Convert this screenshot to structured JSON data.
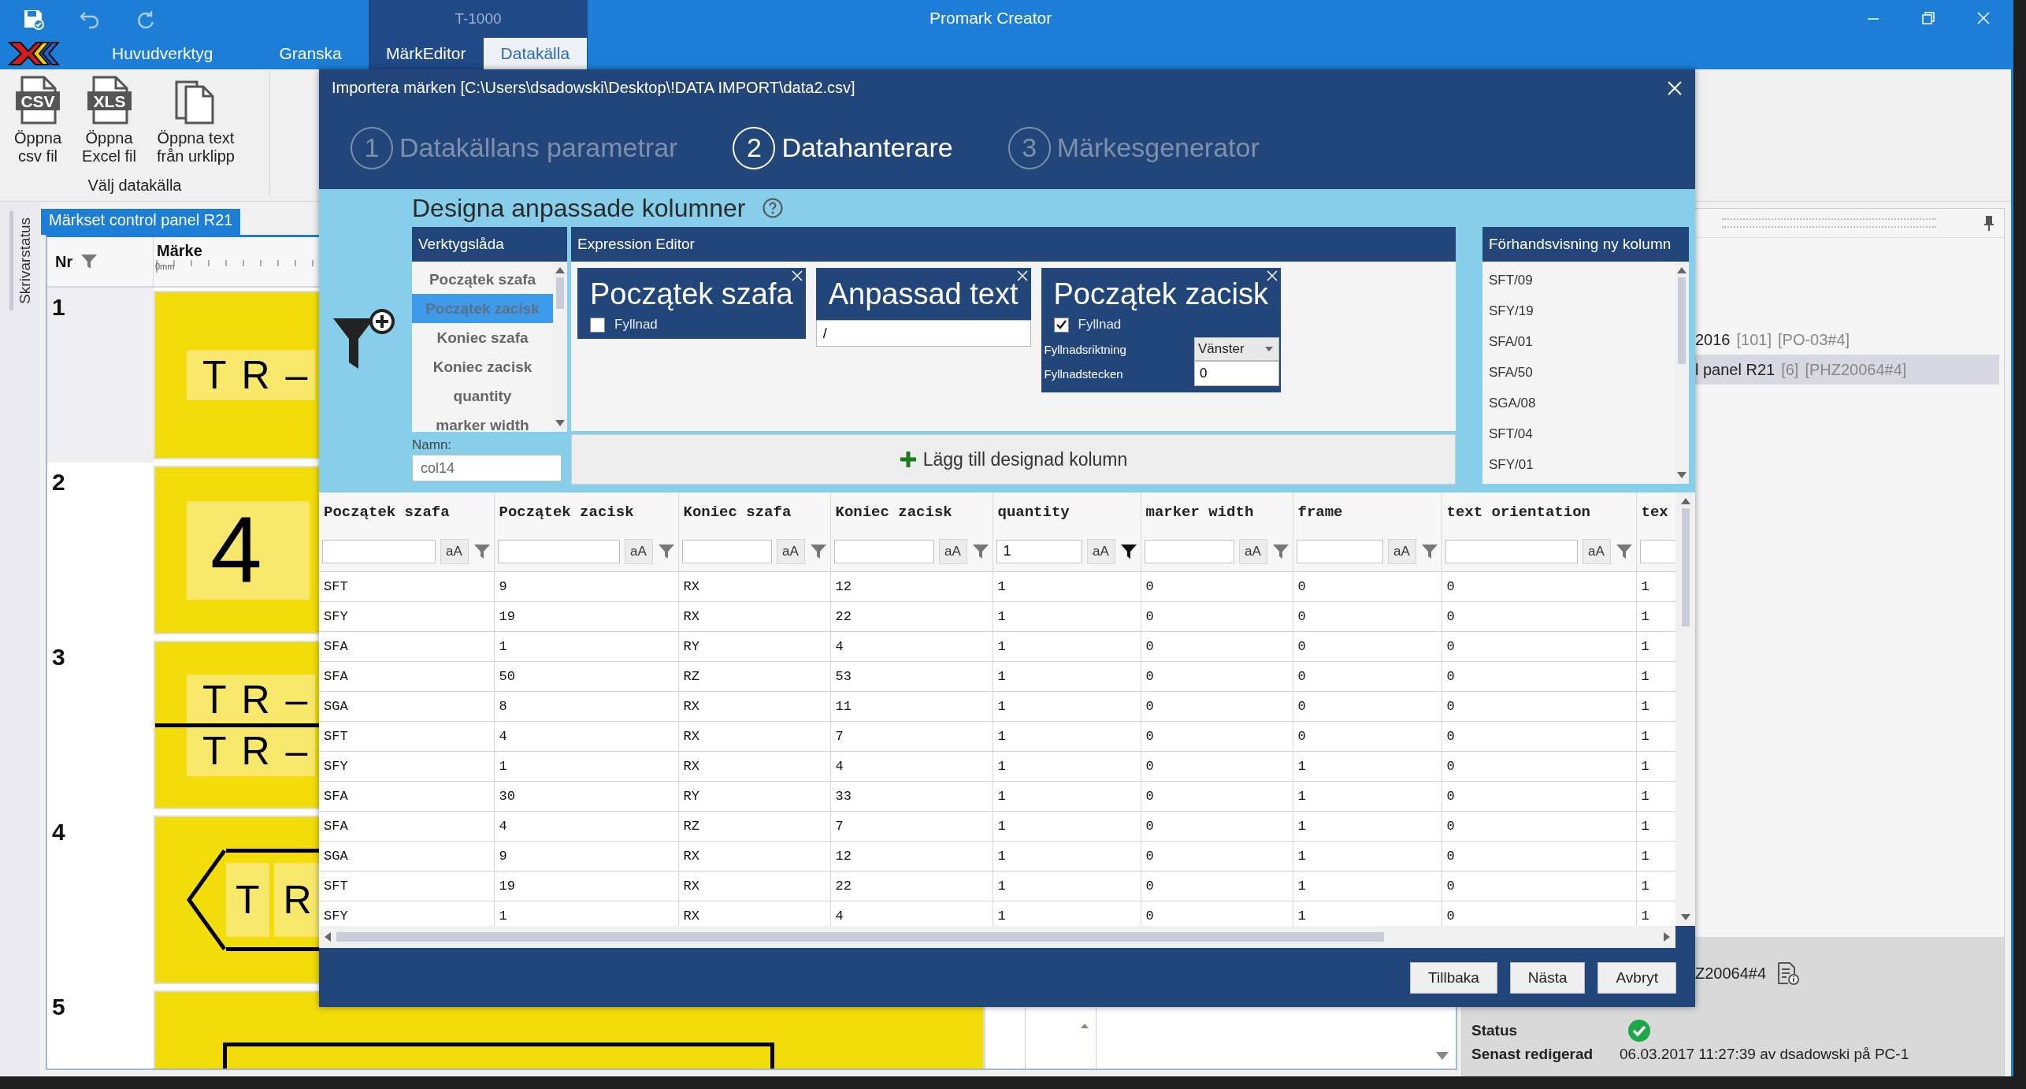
{
  "app": {
    "title": "Promark Creator",
    "tabs": [
      {
        "label": "Huvudverktyg",
        "selected": false
      },
      {
        "label": "Granska",
        "selected": false
      }
    ],
    "context_group": {
      "label": "T-1000",
      "tabs": [
        {
          "label": "MärkEditor",
          "selected": false
        },
        {
          "label": "Datakälla",
          "selected": true
        }
      ]
    }
  },
  "ribbon": {
    "groups": [
      {
        "label": "Välj datakälla",
        "buttons": [
          {
            "label": "Öppna\ncsv fil",
            "kind": "file-badge",
            "badge": "CSV"
          },
          {
            "label": "Öppna\nExcel fil",
            "kind": "file-badge",
            "badge": "XLS"
          },
          {
            "label": "Öppna text\nfrån urklipp",
            "kind": "clipboard"
          }
        ]
      }
    ]
  },
  "document": {
    "side_tab": "Skrivarstatus",
    "tab": "Märkset control panel R21",
    "nr_header": "Nr",
    "marker_header": "Märke",
    "ruler_label": "0mm",
    "markers": [
      {
        "number": "1",
        "selected": true,
        "kind": "single",
        "lines": [
          "T R –"
        ]
      },
      {
        "number": "2",
        "selected": false,
        "kind": "big",
        "lines": [
          "4"
        ]
      },
      {
        "number": "3",
        "selected": false,
        "kind": "double",
        "lines": [
          "T R –",
          "T R –"
        ]
      },
      {
        "number": "4",
        "selected": false,
        "kind": "arrow",
        "lines": [
          "T",
          "R"
        ]
      },
      {
        "number": "5",
        "selected": false,
        "kind": "frame"
      }
    ]
  },
  "right_panel": {
    "items": [
      {
        "name": "2016",
        "count": "[101]",
        "code": "[PO-03#4]",
        "selected": false
      },
      {
        "name": "l panel R21",
        "count": "[6]",
        "code": "[PHZ20064#4]",
        "selected": true
      }
    ],
    "info": {
      "id": "Z20064#4",
      "status_label": "Status",
      "status_ok": true,
      "edited_label": "Senast redigerad",
      "edited": "06.03.2017 11:27:39 av dsadowski på PC-1"
    }
  },
  "dialog": {
    "title": "Importera märken [C:\\Users\\dsadowski\\Desktop\\!DATA IMPORT\\data2.csv]",
    "steps": [
      {
        "number": "1",
        "label": "Datakällans parametrar",
        "selected": false
      },
      {
        "number": "2",
        "label": "Datahanterare",
        "selected": true
      },
      {
        "number": "3",
        "label": "Märkesgenerator",
        "selected": false
      }
    ],
    "designer": {
      "title": "Designa anpassade kolumner",
      "toolbox": {
        "header": "Verktygslåda",
        "items": [
          {
            "label": "Początek szafa",
            "selected": false
          },
          {
            "label": "Początek zacisk",
            "selected": true
          },
          {
            "label": "Koniec szafa",
            "selected": false
          },
          {
            "label": "Koniec zacisk",
            "selected": false
          },
          {
            "label": "quantity",
            "selected": false
          },
          {
            "label": "marker width",
            "selected": false
          }
        ]
      },
      "name_label": "Namn:",
      "name_value": "col14",
      "editor": {
        "header": "Expression Editor",
        "blocks": [
          {
            "kind": "field",
            "title": "Początek szafa",
            "fill_label": "Fyllnad",
            "checked": false
          },
          {
            "kind": "text",
            "title": "Anpassad text",
            "value": "/"
          },
          {
            "kind": "field",
            "title": "Początek zacisk",
            "fill_label": "Fyllnad",
            "checked": true,
            "direction_label": "Fyllnadsriktning",
            "direction": "Vänster",
            "char_label": "Fyllnadstecken",
            "char": "0"
          }
        ],
        "add_button": "Lägg till designad kolumn"
      },
      "preview": {
        "header": "Förhandsvisning ny kolumn",
        "items": [
          "SFT/09",
          "SFY/19",
          "SFA/01",
          "SFA/50",
          "SGA/08",
          "SFT/04",
          "SFY/01"
        ]
      }
    },
    "table": {
      "columns": [
        {
          "label": "Początek szafa",
          "case_button": "aA",
          "active": false
        },
        {
          "label": "Początek zacisk",
          "case_button": "aA",
          "active": false
        },
        {
          "label": "Koniec szafa",
          "case_button": "aA",
          "active": false
        },
        {
          "label": "Koniec zacisk",
          "case_button": "aA",
          "active": false
        },
        {
          "label": "quantity",
          "filter": "1",
          "case_button": "aA",
          "active": true
        },
        {
          "label": "marker width",
          "case_button": "aA",
          "active": false
        },
        {
          "label": "frame",
          "case_button": "aA",
          "active": false
        },
        {
          "label": "text orientation",
          "case_button": "aA",
          "active": false
        },
        {
          "label": "tex"
        }
      ],
      "rows": [
        [
          "SFT",
          "9",
          "RX",
          "12",
          "1",
          "0",
          "0",
          "0",
          "1"
        ],
        [
          "SFY",
          "19",
          "RX",
          "22",
          "1",
          "0",
          "0",
          "0",
          "1"
        ],
        [
          "SFA",
          "1",
          "RY",
          "4",
          "1",
          "0",
          "0",
          "0",
          "1"
        ],
        [
          "SFA",
          "50",
          "RZ",
          "53",
          "1",
          "0",
          "0",
          "0",
          "1"
        ],
        [
          "SGA",
          "8",
          "RX",
          "11",
          "1",
          "0",
          "0",
          "0",
          "1"
        ],
        [
          "SFT",
          "4",
          "RX",
          "7",
          "1",
          "0",
          "0",
          "0",
          "1"
        ],
        [
          "SFY",
          "1",
          "RX",
          "4",
          "1",
          "0",
          "1",
          "0",
          "1"
        ],
        [
          "SFA",
          "30",
          "RY",
          "33",
          "1",
          "0",
          "1",
          "0",
          "1"
        ],
        [
          "SFA",
          "4",
          "RZ",
          "7",
          "1",
          "0",
          "1",
          "0",
          "1"
        ],
        [
          "SGA",
          "9",
          "RX",
          "12",
          "1",
          "0",
          "1",
          "0",
          "1"
        ],
        [
          "SFT",
          "19",
          "RX",
          "22",
          "1",
          "0",
          "1",
          "0",
          "1"
        ],
        [
          "SFY",
          "1",
          "RX",
          "4",
          "1",
          "0",
          "1",
          "0",
          "1"
        ]
      ]
    },
    "buttons": [
      "Tillbaka",
      "Nästa",
      "Avbryt"
    ]
  }
}
